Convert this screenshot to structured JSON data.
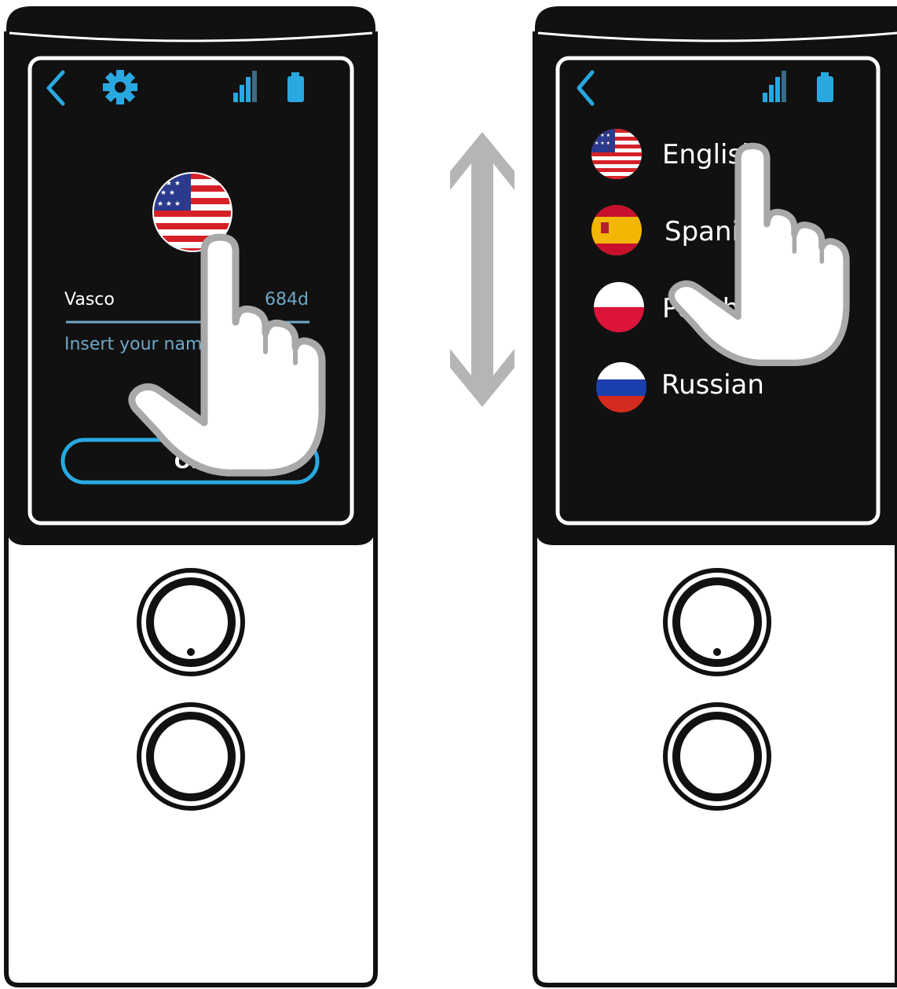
{
  "icons": {
    "back": "chevron-left-icon",
    "settings": "gear-icon",
    "signal": "signal-bars-icon",
    "battery": "battery-icon",
    "scroll": "double-arrow-vertical-icon",
    "hand": "pointing-hand-icon",
    "flag_us": "us-flag-icon",
    "flag_es": "spain-flag-icon",
    "flag_pl": "poland-flag-icon",
    "flag_ru": "russia-flag-icon"
  },
  "colors": {
    "accent": "#29a8e0",
    "screen_bg": "#111111",
    "device_body": "#111111",
    "hint_text": "#6fa8c8"
  },
  "left_device": {
    "profile": {
      "name_value": "Vasco",
      "counter": "684d",
      "name_placeholder": "Insert your nam"
    },
    "ok_button_label": "OK"
  },
  "right_device": {
    "languages": [
      {
        "label": "English"
      },
      {
        "label": "Spani"
      },
      {
        "label": "Polish"
      },
      {
        "label": "Russian"
      }
    ]
  }
}
